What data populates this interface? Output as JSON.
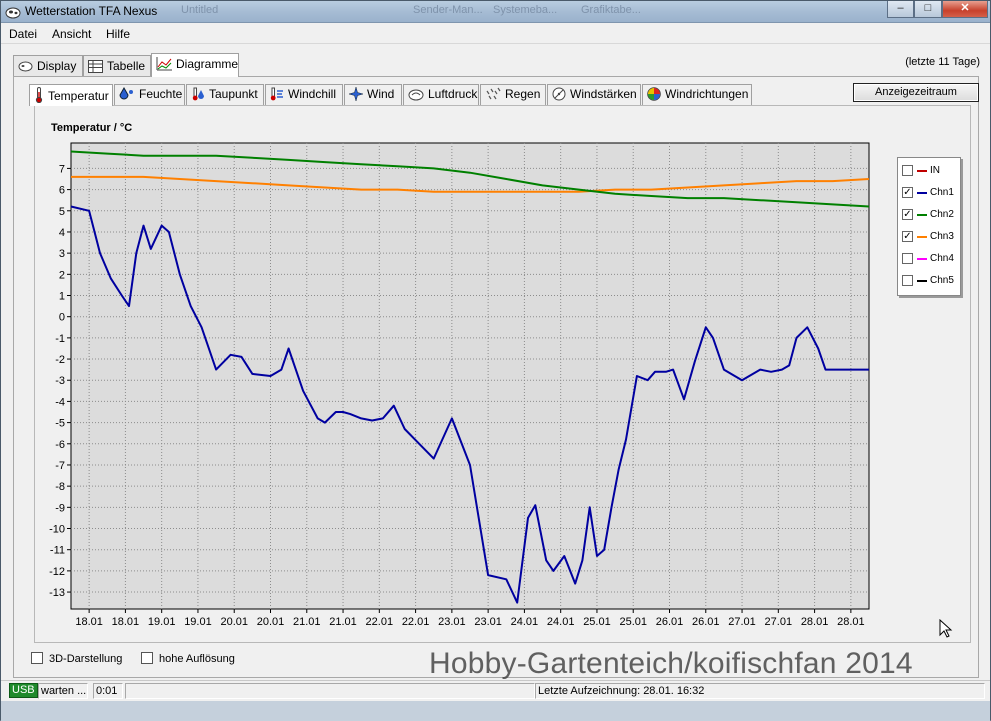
{
  "window": {
    "title": "Wetterstation TFA Nexus",
    "background_titles": [
      "Untitled",
      "Sender-Man...",
      "Systemeba...",
      "Grafiktabe..."
    ],
    "minimize": "–",
    "maximize": "□",
    "close": "✕"
  },
  "menu": [
    "Datei",
    "Ansicht",
    "Hilfe"
  ],
  "view_tabs": [
    {
      "label": "Display",
      "icon": "display-icon",
      "active": false
    },
    {
      "label": "Tabelle",
      "icon": "table-icon",
      "active": false
    },
    {
      "label": "Diagramme",
      "icon": "chart-icon",
      "active": true
    }
  ],
  "range_label": "(letzte 11 Tage)",
  "sensor_tabs": [
    {
      "label": "Temperatur",
      "icon": "thermometer-icon",
      "active": true
    },
    {
      "label": "Feuchte",
      "icon": "humidity-icon"
    },
    {
      "label": "Taupunkt",
      "icon": "dewpoint-icon"
    },
    {
      "label": "Windchill",
      "icon": "windchill-icon"
    },
    {
      "label": "Wind",
      "icon": "wind-icon"
    },
    {
      "label": "Luftdruck",
      "icon": "pressure-icon"
    },
    {
      "label": "Regen",
      "icon": "rain-icon"
    },
    {
      "label": "Windstärken",
      "icon": "windforce-icon"
    },
    {
      "label": "Windrichtungen",
      "icon": "winddirection-icon"
    }
  ],
  "display_period_button": "Anzeigezeitraum",
  "chart_data": {
    "type": "line",
    "title": "Temperatur / °C",
    "ylim": [
      -13.8,
      8.2
    ],
    "yticks": [
      7,
      6,
      5,
      4,
      3,
      2,
      1,
      0,
      -1,
      -2,
      -3,
      -4,
      -5,
      -6,
      -7,
      -8,
      -9,
      -10,
      -11,
      -12,
      -13
    ],
    "x_tick_labels": [
      "18.01",
      "18.01",
      "19.01",
      "19.01",
      "20.01",
      "20.01",
      "21.01",
      "21.01",
      "22.01",
      "22.01",
      "23.01",
      "23.01",
      "24.01",
      "24.01",
      "25.01",
      "25.01",
      "26.01",
      "26.01",
      "27.01",
      "27.01",
      "28.01",
      "28.01"
    ],
    "xlim": [
      0,
      22
    ],
    "grid": true,
    "legend_position": "right",
    "series": [
      {
        "name": "Chn1",
        "color": "#0000a0",
        "checked": true,
        "x": [
          0,
          0.5,
          0.8,
          1.1,
          1.4,
          1.6,
          1.8,
          2.0,
          2.2,
          2.5,
          2.7,
          3.0,
          3.3,
          3.6,
          4.0,
          4.4,
          4.7,
          5.0,
          5.5,
          5.8,
          6.0,
          6.4,
          6.8,
          7.0,
          7.3,
          7.5,
          7.7,
          8.0,
          8.3,
          8.6,
          8.9,
          9.2,
          9.6,
          10.0,
          10.5,
          11.0,
          11.5,
          12.0,
          12.3,
          12.6,
          12.8,
          13.1,
          13.3,
          13.6,
          13.9,
          14.1,
          14.3,
          14.5,
          14.7,
          14.9,
          15.1,
          15.3,
          15.6,
          15.9,
          16.1,
          16.4,
          16.6,
          16.9,
          17.2,
          17.5,
          17.7,
          18.0,
          18.5,
          19.0,
          19.3,
          19.6,
          19.8,
          20.0,
          20.3,
          20.6,
          20.8,
          21.0,
          21.2,
          21.5,
          21.8,
          22.0
        ],
        "y": [
          5.2,
          5.0,
          3.0,
          1.8,
          1.0,
          0.5,
          3.0,
          4.3,
          3.2,
          4.3,
          4.0,
          2.0,
          0.5,
          -0.5,
          -2.5,
          -1.8,
          -1.9,
          -2.7,
          -2.8,
          -2.5,
          -1.5,
          -3.5,
          -4.8,
          -5.0,
          -4.5,
          -4.5,
          -4.6,
          -4.8,
          -4.9,
          -4.8,
          -4.2,
          -5.3,
          -6.0,
          -6.7,
          -4.8,
          -7.0,
          -12.2,
          -12.4,
          -13.5,
          -9.5,
          -8.9,
          -11.5,
          -12.0,
          -11.3,
          -12.6,
          -11.5,
          -9.0,
          -11.3,
          -11.0,
          -9.0,
          -7.2,
          -5.8,
          -2.8,
          -3.0,
          -2.6,
          -2.6,
          -2.5,
          -3.9,
          -2.1,
          -0.5,
          -1.0,
          -2.5,
          -3.0,
          -2.5,
          -2.6,
          -2.5,
          -2.3,
          -1.0,
          -0.5,
          -1.5,
          -2.5,
          -2.5,
          -2.5,
          -2.5,
          -2.5,
          -2.5
        ]
      },
      {
        "name": "Chn2",
        "color": "#008000",
        "checked": true,
        "x": [
          0,
          1,
          2,
          3,
          4,
          5,
          6,
          7,
          8,
          9,
          10,
          11,
          12,
          13,
          14,
          15,
          16,
          17,
          18,
          19,
          20,
          21,
          22
        ],
        "y": [
          7.8,
          7.7,
          7.6,
          7.6,
          7.6,
          7.5,
          7.4,
          7.3,
          7.2,
          7.1,
          7.0,
          6.8,
          6.5,
          6.2,
          6.0,
          5.8,
          5.7,
          5.6,
          5.6,
          5.5,
          5.4,
          5.3,
          5.2
        ]
      },
      {
        "name": "Chn3",
        "color": "#ff8000",
        "checked": true,
        "x": [
          0,
          1,
          2,
          3,
          4,
          5,
          6,
          7,
          8,
          9,
          10,
          11,
          12,
          13,
          14,
          15,
          16,
          17,
          18,
          19,
          20,
          21,
          22
        ],
        "y": [
          6.6,
          6.6,
          6.6,
          6.5,
          6.4,
          6.3,
          6.2,
          6.1,
          6.0,
          6.0,
          5.9,
          5.9,
          5.9,
          5.9,
          5.9,
          6.0,
          6.0,
          6.1,
          6.2,
          6.3,
          6.4,
          6.4,
          6.5
        ]
      }
    ]
  },
  "legend": [
    {
      "label": "IN",
      "color": "#c00000",
      "checked": false
    },
    {
      "label": "Chn1",
      "color": "#0000a0",
      "checked": true
    },
    {
      "label": "Chn2",
      "color": "#008000",
      "checked": true
    },
    {
      "label": "Chn3",
      "color": "#ff8000",
      "checked": true
    },
    {
      "label": "Chn4",
      "color": "#ff00ff",
      "checked": false
    },
    {
      "label": "Chn5",
      "color": "#000000",
      "checked": false
    }
  ],
  "options": {
    "three_d": "3D-Darstellung",
    "high_res": "hohe Auflösung"
  },
  "watermark": "Hobby-Gartenteich/koifischfan 2014",
  "status": {
    "usb": "USB",
    "state": "warten ...",
    "time": "0:01",
    "last_record": "Letzte Aufzeichnung: 28.01. 16:32"
  }
}
